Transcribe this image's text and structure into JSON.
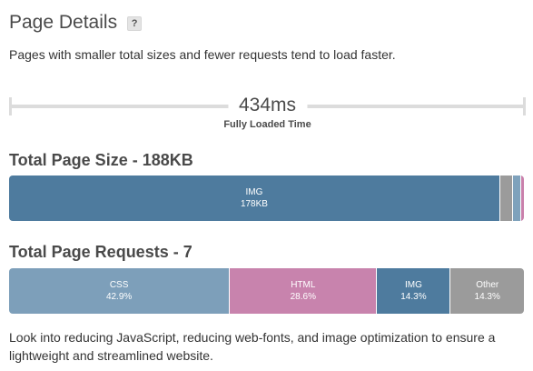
{
  "header": {
    "title": "Page Details",
    "help_icon": "?"
  },
  "subtitle": "Pages with smaller total sizes and fewer requests tend to load faster.",
  "timing": {
    "value": "434ms",
    "label": "Fully Loaded Time"
  },
  "page_size": {
    "title": "Total Page Size - 188KB",
    "segments": [
      {
        "name": "IMG",
        "value": "178KB",
        "fraction": 0.954,
        "color": "#4e7b9e"
      },
      {
        "name": "",
        "value": "",
        "fraction": 0.025,
        "color": "#9b9b9b"
      },
      {
        "name": "",
        "value": "",
        "fraction": 0.015,
        "color": "#7fa2bc"
      },
      {
        "name": "",
        "value": "",
        "fraction": 0.006,
        "color": "#c980ab"
      }
    ]
  },
  "page_requests": {
    "title": "Total Page Requests - 7",
    "segments": [
      {
        "name": "CSS",
        "value": "42.9%",
        "fraction": 0.429,
        "color": "#7d9fba"
      },
      {
        "name": "HTML",
        "value": "28.6%",
        "fraction": 0.286,
        "color": "#c883ad"
      },
      {
        "name": "IMG",
        "value": "14.3%",
        "fraction": 0.143,
        "color": "#4e7b9e"
      },
      {
        "name": "Other",
        "value": "14.3%",
        "fraction": 0.142,
        "color": "#9b9b9b"
      }
    ]
  },
  "footer": "Look into reducing JavaScript, reducing web-fonts, and image optimization to ensure a lightweight and streamlined website."
}
